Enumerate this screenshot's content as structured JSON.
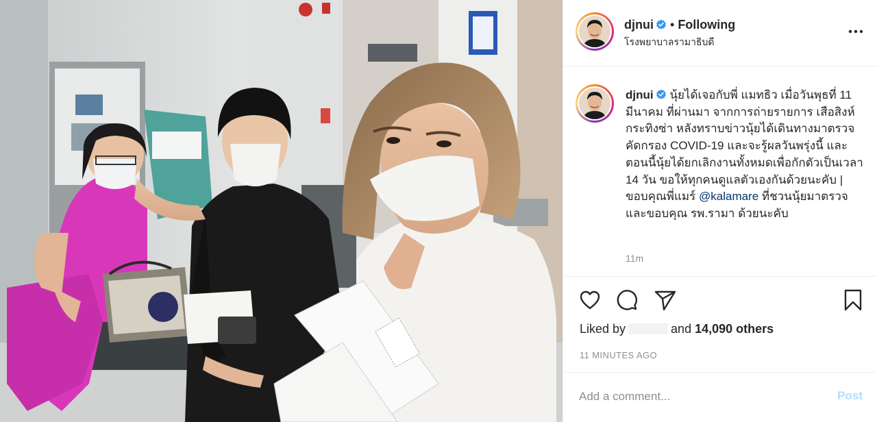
{
  "post": {
    "author": "djnui",
    "verified": true,
    "follow_status": "Following",
    "location": "โรงพยาบาลรามาธิบดี",
    "caption_before_mention": "นุ้ยได้เจอกับพี่ แมทธิว เมื่อวันพุธที่ 11 มีนาคม ที่ผ่านมา จากการถ่ายรายการ เสือสิงห์กระทิงซ่า หลังทราบข่าวนุ้ยได้เดินทางมาตรวจคัดกรอง COVID-19 และจะรู้ผลวันพรุ่งนี้ และตอนนี้นุ้ยได้ยกเลิกงานทั้งหมดเพื่อกักตัวเป็นเวลา 14 วัน ขอให้ทุกคนดูแลตัวเองกันด้วยนะคับ | ขอบคุณพี่แมร์ ",
    "mention": "@kalamare",
    "caption_after_mention": " ที่ชวนนุ้ยมาตรวจและขอบคุณ รพ.รามา ด้วยนะคับ",
    "caption_time": "11m",
    "likes_prefix": "Liked by",
    "likes_and": "and",
    "likes_count": "14,090 others",
    "posted_ago": "11 MINUTES AGO"
  },
  "icons": {
    "more": "more-horizontal-icon",
    "like": "heart-outline-icon",
    "comment": "comment-bubble-icon",
    "share": "paper-plane-icon",
    "save": "bookmark-icon",
    "verified": "verified-badge-icon"
  },
  "comment": {
    "placeholder": "Add a comment...",
    "post_label": "Post"
  },
  "colors": {
    "verified_blue": "#3897f0",
    "muted_text": "#8e8e8e",
    "mention": "#00376b",
    "post_button_disabled": "#b3dbff"
  }
}
